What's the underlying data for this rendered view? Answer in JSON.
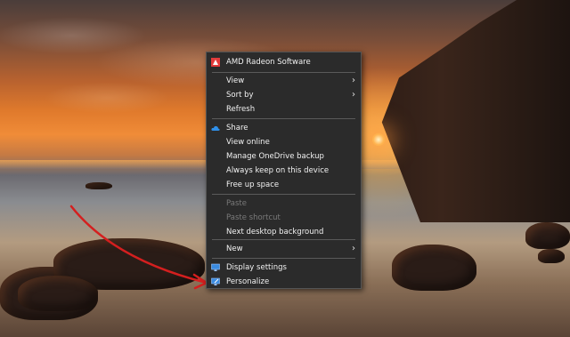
{
  "menu": {
    "header": {
      "label": "AMD Radeon Software",
      "icon": "amd-radeon-icon"
    },
    "group1": [
      {
        "label": "View",
        "submenu": true
      },
      {
        "label": "Sort by",
        "submenu": true
      },
      {
        "label": "Refresh",
        "submenu": false
      }
    ],
    "onedrive": [
      {
        "label": "Share",
        "icon": "onedrive-cloud-icon"
      },
      {
        "label": "View online"
      },
      {
        "label": "Manage OneDrive backup"
      },
      {
        "label": "Always keep on this device"
      },
      {
        "label": "Free up space"
      }
    ],
    "clipboard": [
      {
        "label": "Paste",
        "disabled": true
      },
      {
        "label": "Paste shortcut",
        "disabled": true
      },
      {
        "label": "Next desktop background",
        "disabled": false
      }
    ],
    "new": {
      "label": "New",
      "submenu": true
    },
    "display": [
      {
        "label": "Display settings",
        "icon": "display-settings-icon"
      },
      {
        "label": "Personalize",
        "icon": "personalize-icon"
      }
    ],
    "colors": {
      "background": "#2b2b2b",
      "text": "#f2f2f2",
      "disabled": "#7a7a7a",
      "annotation_arrow": "#d41f1f"
    }
  }
}
